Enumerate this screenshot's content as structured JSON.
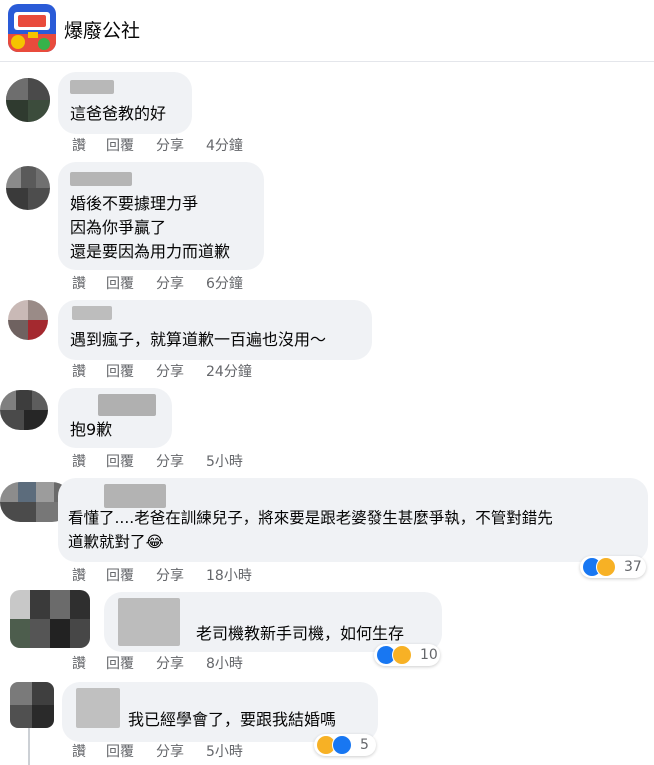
{
  "header": {
    "title": "爆廢公社",
    "logo_icon": "baofei-logo-icon"
  },
  "action_labels": {
    "like": "讚",
    "reply": "回覆",
    "share": "分享"
  },
  "comments": [
    {
      "text": "這爸爸教的好",
      "time": "4分鐘"
    },
    {
      "text": "婚後不要據理力爭\n因為你爭贏了\n還是要因為用力而道歉",
      "time": "6分鐘"
    },
    {
      "text": "遇到瘋子，就算道歉一百遍也沒用～",
      "time": "24分鐘"
    },
    {
      "text": "抱9歉",
      "time": "5小時"
    },
    {
      "text": "看懂了....老爸在訓練兒子，將來要是跟老婆發生甚麼爭執，不管對錯先\n道歉就對了😂",
      "time": "18小時",
      "reaction_count": "37"
    },
    {
      "text": "老司機教新手司機，如何生存",
      "time": "8小時",
      "reaction_count": "10"
    },
    {
      "text": "我已經學會了，要跟我結婚嗎",
      "time": "5小時",
      "reaction_count": "5"
    }
  ],
  "colors": {
    "bubble": "#f0f2f5",
    "meta_text": "#65676b",
    "like_blue": "#1877f2",
    "haha_yellow": "#f7b125"
  }
}
